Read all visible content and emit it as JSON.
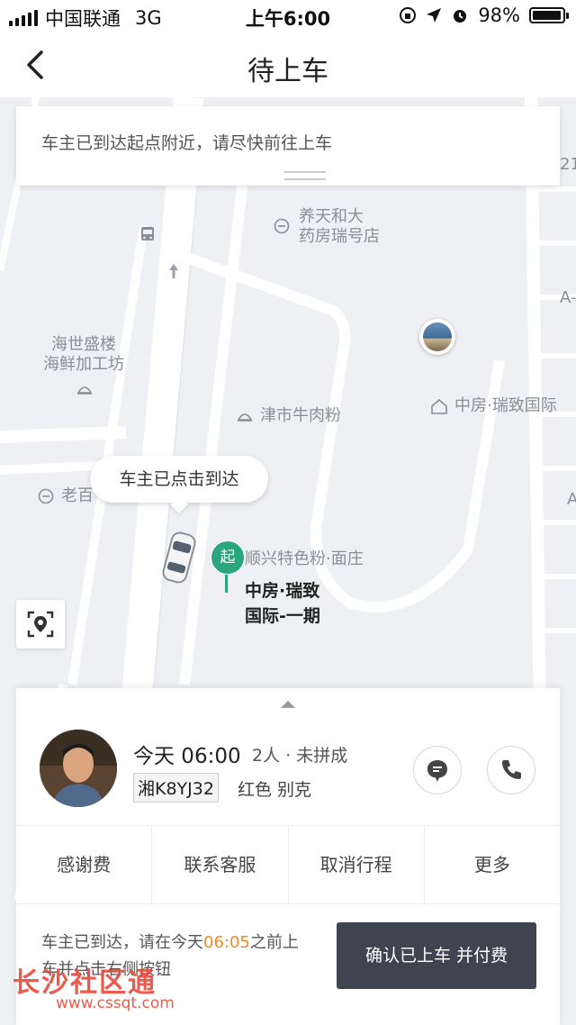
{
  "status_bar": {
    "carrier": "中国联通",
    "network": "3G",
    "time": "上午6:00",
    "battery": "98%",
    "battery_level": 0.98
  },
  "nav": {
    "title": "待上车"
  },
  "map": {
    "notice": "车主已到达起点附近，请尽快前往上车",
    "bubble": "车主已点击到达",
    "start_pin": "起",
    "start_label_line1": "中房·瑞致",
    "start_label_line2": "国际-一期",
    "pois": {
      "yangtian_1": "养天和大",
      "yangtian_2": "药房瑞号店",
      "haishi_1": "海世盛楼",
      "haishi_2": "海鲜加工坊",
      "jinshi": "津市牛肉粉",
      "zhongfang": "中房·瑞致国际",
      "laobai": "老百",
      "shunxing": "顺兴特色粉·面庄",
      "edge_21": "21",
      "edge_a": "A-",
      "edge_a2": "A"
    }
  },
  "trip": {
    "time": "今天 06:00",
    "meta": "2人 · 未拼成",
    "plate": "湘K8YJ32",
    "car": "红色 别克"
  },
  "actions": [
    "感谢费",
    "联系客服",
    "取消行程",
    "更多"
  ],
  "footer": {
    "text_before": "车主已到达，请在今天",
    "highlight_time": "06:05",
    "text_after": "之前上车并点击右侧按钮",
    "pay_button": "确认已上车 并付费"
  },
  "watermark": {
    "name": "长沙社区通",
    "url": "www.cssqt.com"
  },
  "colors": {
    "accent_green": "#2aa57c",
    "highlight_orange": "#f08a24",
    "pay_button": "#3e4450",
    "watermark_red": "#e8493a"
  }
}
